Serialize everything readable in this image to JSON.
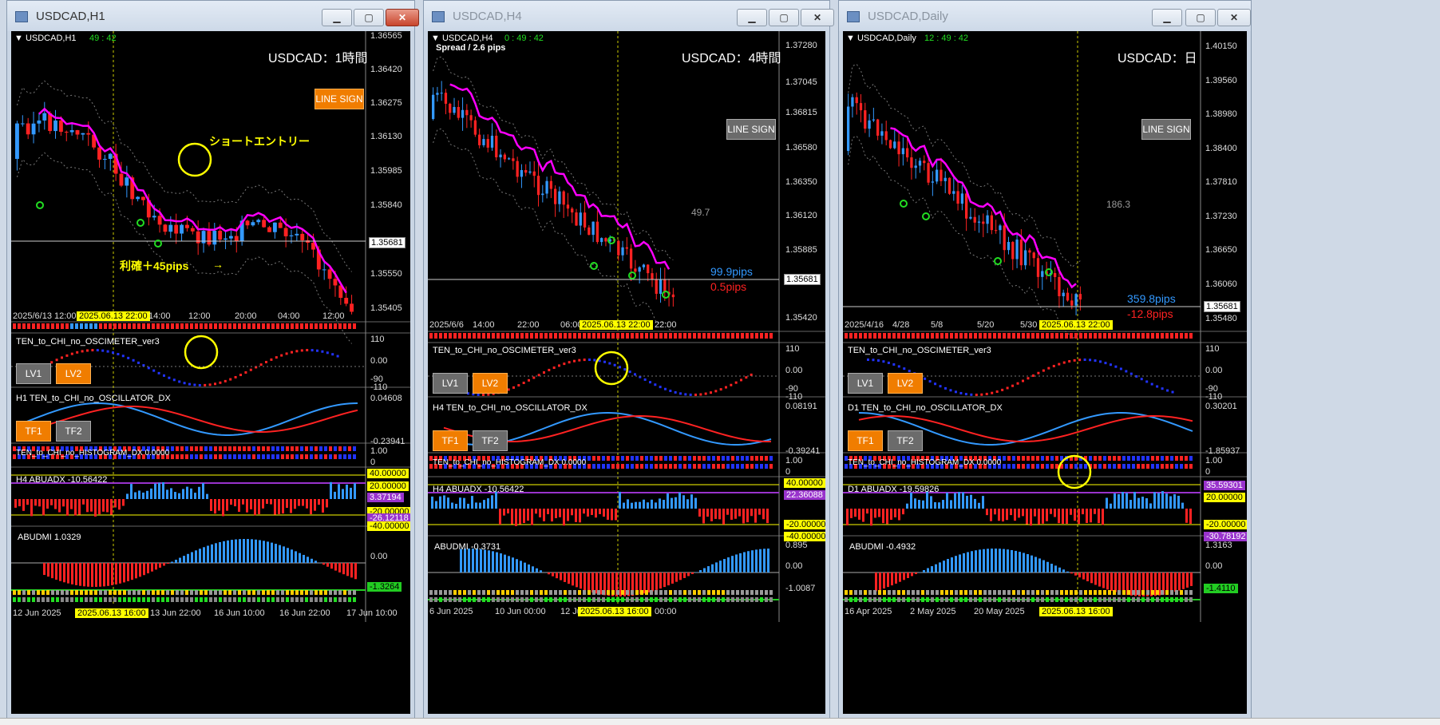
{
  "windows": [
    {
      "title": "USDCAD,H1",
      "symbol": "USDCAD,H1",
      "clock": "49 : 42",
      "chart_title": "USDCAD：1時間",
      "line_sign": "LINE SIGN",
      "annotation_entry": "ショートエントリー",
      "annotation_profit": "利確＋45pips",
      "price_axis": [
        "1.36565",
        "1.36420",
        "1.36275",
        "1.36130",
        "1.35985",
        "1.35840",
        "1.35681",
        "1.35550",
        "1.35405"
      ],
      "current_price": "1.35681",
      "time_axis": [
        "2025/6/13 12:00",
        "14:00",
        "12:00",
        "20:00",
        "04:00",
        "12:00"
      ],
      "time_highlight": "2025.06.13 22:00",
      "osc_label": "TEN_to_CHI_no_OSCIMETER_ver3",
      "osc_axis": [
        "110",
        "0.00",
        "-90",
        "-110"
      ],
      "lv1": "LV1",
      "lv2": "LV2",
      "oscillator_label": "H1 TEN_to_CHI_no_OSCILLATOR_DX",
      "oscillator_axis": [
        "0.04608",
        "-0.23941"
      ],
      "tf1": "TF1",
      "tf2": "TF2",
      "histogram_label": "TEN_to_CHI_no_HISTOGRAM_DX 0.0000",
      "hist_axis": [
        "1.00",
        "0"
      ],
      "abuadx_label": "H4 ABUADX -10.56422",
      "abuadx_tags": [
        "40.00000",
        "20.00000",
        "3.37194",
        "-20.00000",
        "-26.12118",
        "-40.00000"
      ],
      "abudmi_label": "ABUDMI 1.0329",
      "abudmi_axis": [
        "0.00",
        "-1.3264"
      ],
      "bottom_time_axis": [
        "12 Jun 2025",
        "13 Jun 22:00",
        "16 Jun 10:00",
        "16 Jun 22:00",
        "17 Jun 10:00"
      ],
      "bottom_highlight": "2025.06.13 16:00",
      "active": true
    },
    {
      "title": "USDCAD,H4",
      "symbol": "USDCAD,H4",
      "clock": "0 : 49 : 42",
      "spread": "Spread / 2.6 pips",
      "chart_title": "USDCAD：4時間",
      "line_sign": "LINE SIGN",
      "price_axis": [
        "1.37280",
        "1.37045",
        "1.36815",
        "1.36580",
        "1.36350",
        "1.36120",
        "1.35885",
        "1.35681",
        "1.35420"
      ],
      "current_price": "1.35681",
      "right_value": "49.7",
      "pips_blue": "99.9pips",
      "pips_red": "0.5pips",
      "time_axis": [
        "2025/6/6",
        "14:00",
        "22:00",
        "06:00",
        "22:00"
      ],
      "time_highlight": "2025.06.13 22:00",
      "osc_label": "TEN_to_CHI_no_OSCIMETER_ver3",
      "osc_axis": [
        "110",
        "0.00",
        "-90",
        "-110"
      ],
      "lv1": "LV1",
      "lv2": "LV2",
      "oscillator_label": "H4 TEN_to_CHI_no_OSCILLATOR_DX",
      "oscillator_axis": [
        "0.08191",
        "-0.39241"
      ],
      "tf1": "TF1",
      "tf2": "TF2",
      "histogram_label": "TEN_to_CHI_no_HISTOGRAM_DX 0.0000",
      "hist_axis": [
        "1.00",
        "0"
      ],
      "abuadx_label": "H4 ABUADX -10.56422",
      "abuadx_tags": [
        "40.00000",
        "22.36088",
        "-20.00000",
        "-40.00000"
      ],
      "abudmi_label": "ABUDMI -0.3731",
      "abudmi_axis": [
        "0.895",
        "0.00",
        "-1.0087"
      ],
      "bottom_time_axis": [
        "6 Jun 2025",
        "10 Jun 00:00",
        "12 Jun",
        "00:00"
      ],
      "bottom_highlight": "2025.06.13 16:00",
      "active": false
    },
    {
      "title": "USDCAD,Daily",
      "symbol": "USDCAD,Daily",
      "clock": "12 : 49 : 42",
      "chart_title": "USDCAD：日",
      "line_sign": "LINE SIGN",
      "price_axis": [
        "1.40150",
        "1.39560",
        "1.38980",
        "1.38400",
        "1.37810",
        "1.37230",
        "1.36650",
        "1.36060",
        "1.35681",
        "1.35480"
      ],
      "current_price": "1.35681",
      "right_value": "186.3",
      "pips_blue": "359.8pips",
      "pips_red": "-12.8pips",
      "time_axis": [
        "2025/4/16",
        "4/28",
        "5/8",
        "5/20",
        "5/30"
      ],
      "time_highlight": "2025.06.13 22:00",
      "osc_label": "TEN_to_CHI_no_OSCIMETER_ver3",
      "osc_axis": [
        "110",
        "0.00",
        "-90",
        "-110"
      ],
      "lv1": "LV1",
      "lv2": "LV2",
      "oscillator_label": "D1 TEN_to_CHI_no_OSCILLATOR_DX",
      "oscillator_axis": [
        "0.30201",
        "-1.85937"
      ],
      "tf1": "TF1",
      "tf2": "TF2",
      "histogram_label": "TEN_to_CHI_no_HISTOGRAM_DX 0.0000",
      "hist_axis": [
        "1.00",
        "0"
      ],
      "abuadx_label": "D1 ABUADX -19.59826",
      "abuadx_tags": [
        "35.59301",
        "20.00000",
        "-20.00000",
        "-30.78192"
      ],
      "abudmi_label": "ABUDMI -0.4932",
      "abudmi_axis": [
        "1.3163",
        "0.00",
        "-1.4110"
      ],
      "bottom_time_axis": [
        "16 Apr 2025",
        "2 May 2025",
        "20 May 2025"
      ],
      "bottom_highlight": "2025.06.13 16:00",
      "active": false
    }
  ],
  "colors": {
    "bull": "#3399ff",
    "bear": "#ff2222",
    "ma": "#ff00ff",
    "lv_orange": "#f07d00",
    "highlight": "#ffff00"
  }
}
